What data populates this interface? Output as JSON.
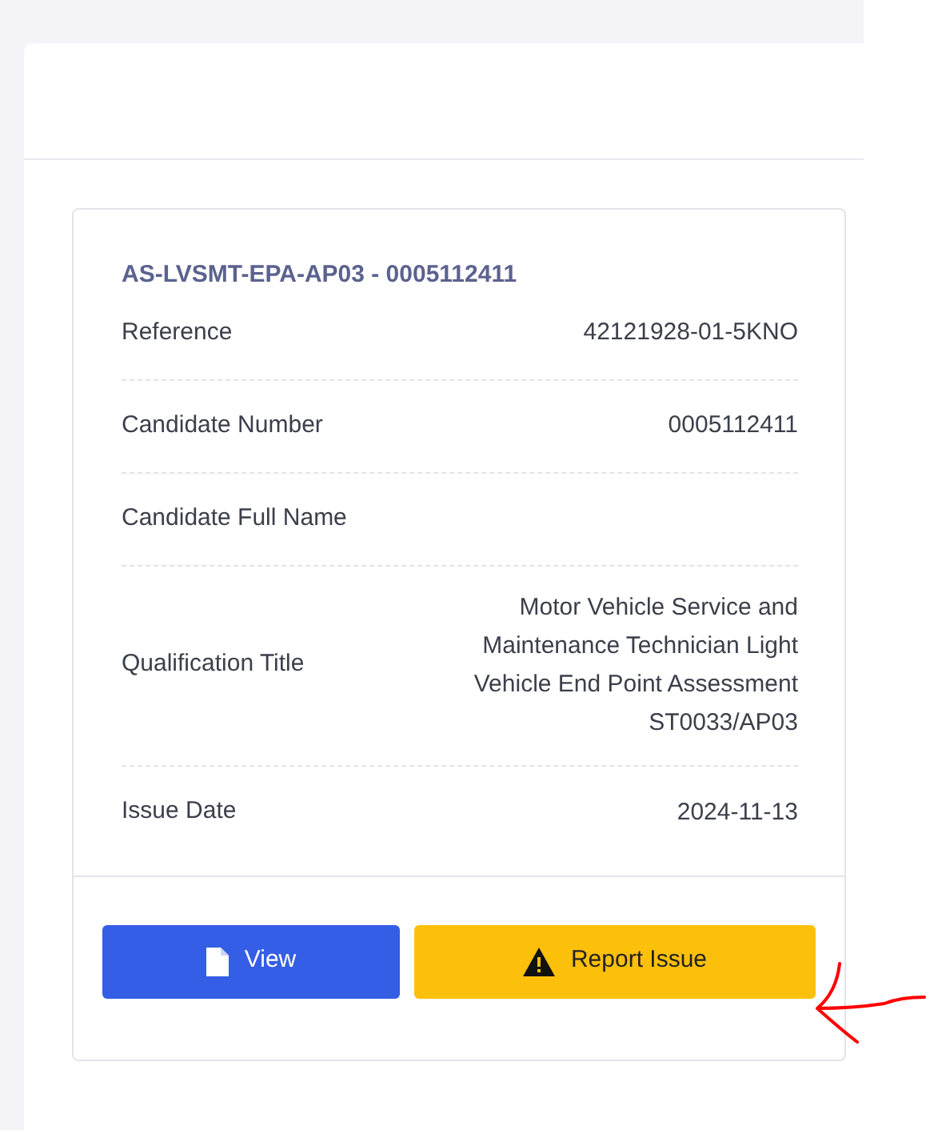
{
  "card": {
    "title": "AS-LVSMT-EPA-AP03 - 0005112411",
    "rows": [
      {
        "label": "Reference",
        "value": "42121928-01-5KNO"
      },
      {
        "label": "Candidate Number",
        "value": "0005112411"
      },
      {
        "label": "Candidate Full Name"
      },
      {
        "label": "Qualification Title",
        "value": "Motor Vehicle Service and Maintenance Technician Light Vehicle End Point Assessment ST0033/AP03"
      },
      {
        "label": "Issue Date",
        "value": "2024-11-13"
      }
    ],
    "buttons": [
      {
        "label": "View",
        "kind": "view"
      },
      {
        "label": "Report Issue",
        "kind": "report"
      }
    ]
  }
}
